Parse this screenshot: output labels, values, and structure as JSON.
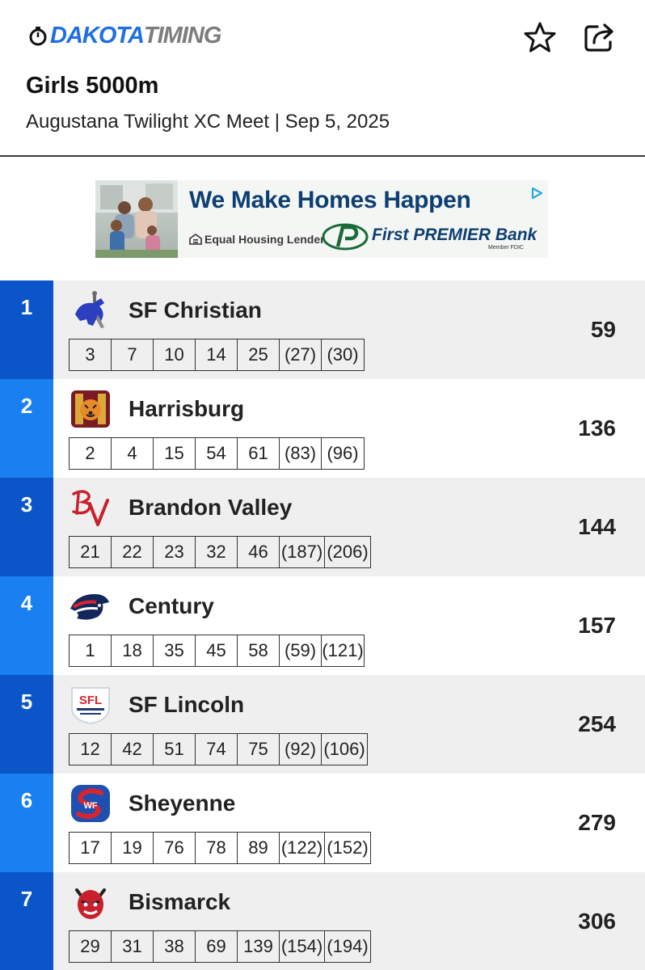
{
  "header": {
    "brand_part1": "DAKOTA",
    "brand_part2": "TIMING",
    "title": "Girls 5000m",
    "subtitle": "Augustana Twilight XC Meet | Sep 5, 2025",
    "icons": {
      "favorite": "star-outline-icon",
      "share": "share-icon",
      "brand": "stopwatch-icon"
    }
  },
  "ad": {
    "headline": "We Make Homes Happen",
    "equal_housing": "Equal Housing Lender",
    "bank_name_part1": "First ",
    "bank_name_part2": "PREMIER",
    "bank_name_part3": " Bank",
    "fdic": "Member FDIC",
    "colors": {
      "navy": "#0e3f73",
      "green": "#1a6b3a"
    }
  },
  "colors": {
    "rank_dark": "#0a55c7",
    "rank_light": "#1a7ff0",
    "row_alt": "#efefef"
  },
  "teams": [
    {
      "rank": "1",
      "name": "SF Christian",
      "score": "59",
      "logo": "knight-horse-logo",
      "places": [
        "3",
        "7",
        "10",
        "14",
        "25",
        "(27)",
        "(30)"
      ]
    },
    {
      "rank": "2",
      "name": "Harrisburg",
      "score": "136",
      "logo": "tiger-logo",
      "places": [
        "2",
        "4",
        "15",
        "54",
        "61",
        "(83)",
        "(96)"
      ]
    },
    {
      "rank": "3",
      "name": "Brandon Valley",
      "score": "144",
      "logo": "bv-script-logo",
      "places": [
        "21",
        "22",
        "23",
        "32",
        "46",
        "(187)",
        "(206)"
      ]
    },
    {
      "rank": "4",
      "name": "Century",
      "score": "157",
      "logo": "patriot-logo",
      "places": [
        "1",
        "18",
        "35",
        "45",
        "58",
        "(59)",
        "(121)"
      ]
    },
    {
      "rank": "5",
      "name": "SF Lincoln",
      "score": "254",
      "logo": "sfl-shield-logo",
      "places": [
        "12",
        "42",
        "51",
        "74",
        "75",
        "(92)",
        "(106)"
      ]
    },
    {
      "rank": "6",
      "name": "Sheyenne",
      "score": "279",
      "logo": "ws-shield-logo",
      "places": [
        "17",
        "19",
        "76",
        "78",
        "89",
        "(122)",
        "(152)"
      ]
    },
    {
      "rank": "7",
      "name": "Bismarck",
      "score": "306",
      "logo": "demon-logo",
      "places": [
        "29",
        "31",
        "38",
        "69",
        "139",
        "(154)",
        "(194)"
      ]
    }
  ]
}
